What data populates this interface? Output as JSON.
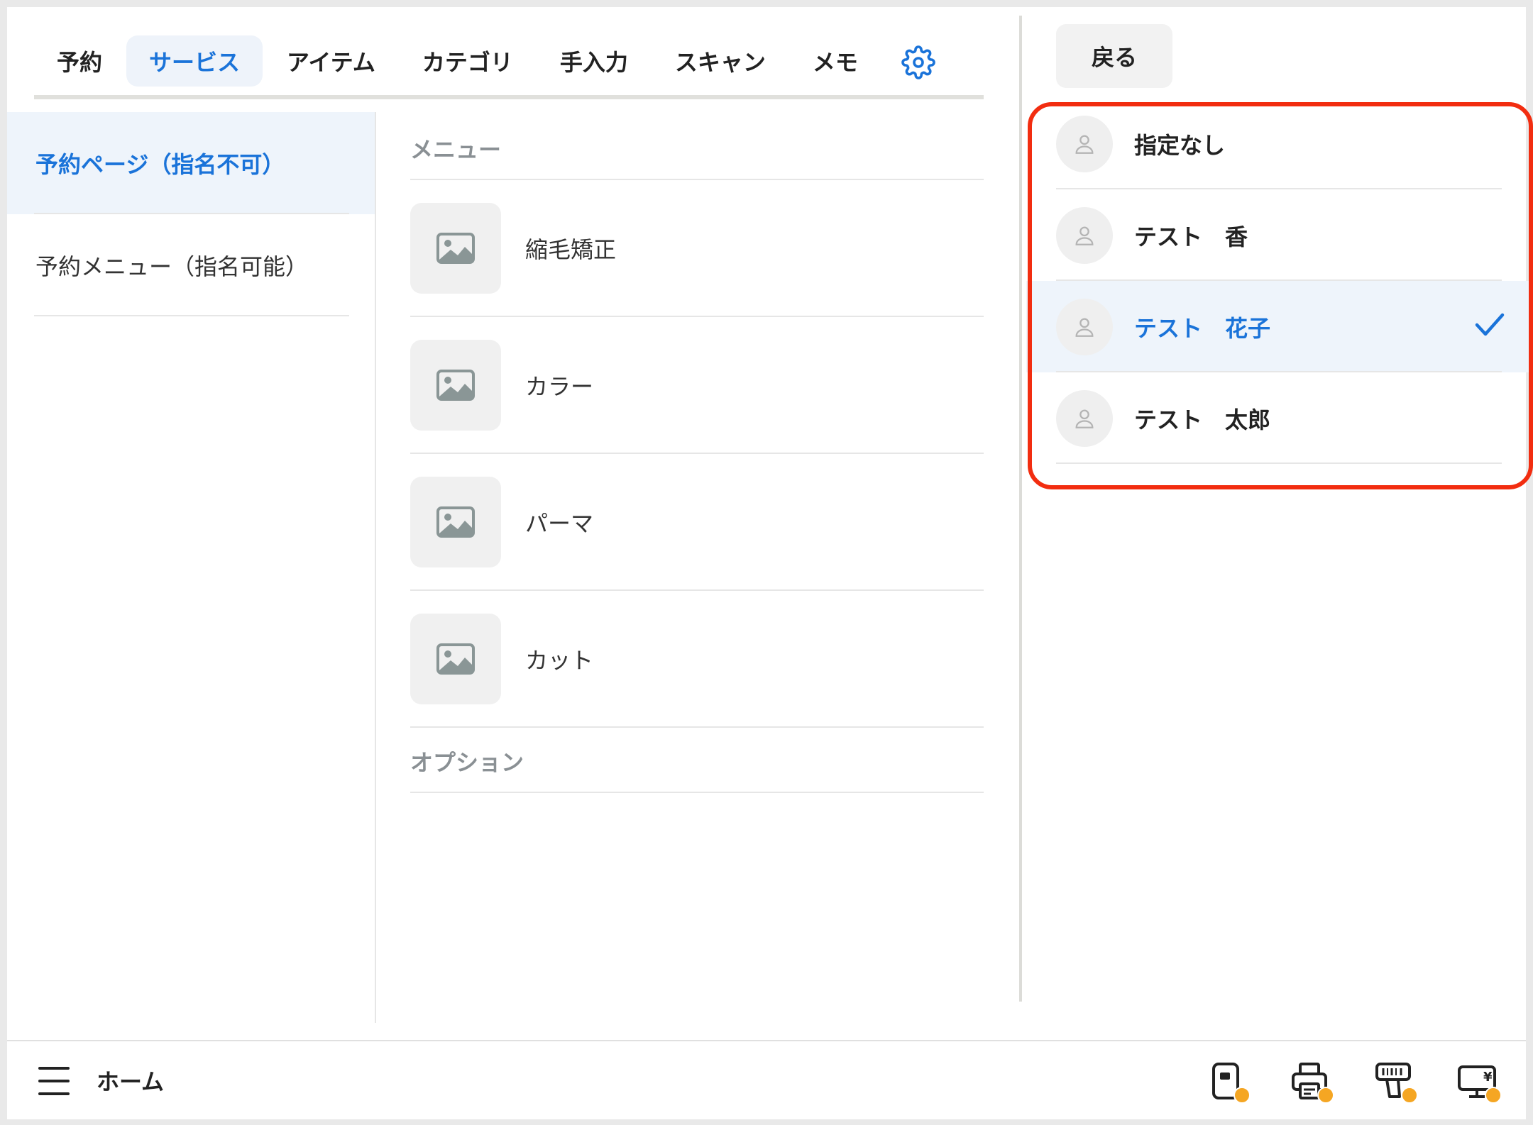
{
  "tabs": [
    {
      "label": "予約"
    },
    {
      "label": "サービス"
    },
    {
      "label": "アイテム"
    },
    {
      "label": "カテゴリ"
    },
    {
      "label": "手入力"
    },
    {
      "label": "スキャン"
    },
    {
      "label": "メモ"
    }
  ],
  "active_tab": "サービス",
  "sidebar": {
    "items": [
      {
        "label": "予約ページ（指名不可）"
      },
      {
        "label": "予約メニュー（指名可能）"
      }
    ]
  },
  "menu": {
    "section_label": "メニュー",
    "items": [
      {
        "label": "縮毛矯正"
      },
      {
        "label": "カラー"
      },
      {
        "label": "パーマ"
      },
      {
        "label": "カット"
      }
    ],
    "option_label": "オプション"
  },
  "staff_panel": {
    "back_label": "戻る",
    "staff": [
      {
        "name": "指定なし"
      },
      {
        "name": "テスト　香"
      },
      {
        "name": "テスト　花子"
      },
      {
        "name": "テスト　太郎"
      }
    ],
    "selected": "テスト　花子"
  },
  "bottom_bar": {
    "home_label": "ホーム",
    "device_icons": [
      "card-reader-icon",
      "receipt-printer-icon",
      "barcode-scanner-icon",
      "customer-display-icon"
    ],
    "status_dot_color": "#f5a623"
  },
  "colors": {
    "accent": "#1a73d9",
    "highlight": "#f22d10",
    "selected_bg": "#eef4fb"
  }
}
